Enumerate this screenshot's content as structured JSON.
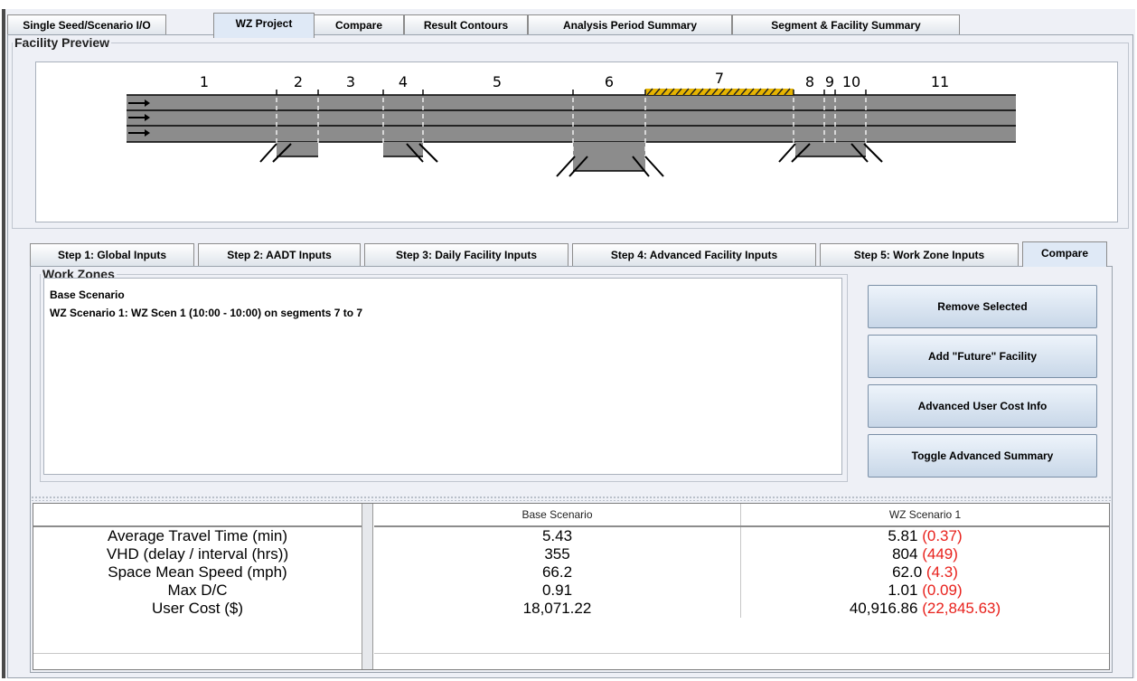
{
  "tabs": [
    {
      "label": "Single Seed/Scenario I/O"
    },
    {
      "label": "WZ Project",
      "active": true
    },
    {
      "label": "Compare"
    },
    {
      "label": "Result Contours"
    },
    {
      "label": "Analysis Period Summary"
    },
    {
      "label": "Segment & Facility Summary"
    }
  ],
  "facility_preview": {
    "legend": "Facility Preview",
    "segment_numbers": [
      "1",
      "2",
      "3",
      "4",
      "5",
      "6",
      "7",
      "8",
      "9",
      "10",
      "11"
    ]
  },
  "step_tabs": [
    {
      "label": "Step 1: Global Inputs"
    },
    {
      "label": "Step 2: AADT Inputs"
    },
    {
      "label": "Step 3: Daily Facility Inputs"
    },
    {
      "label": "Step 4: Advanced Facility Inputs"
    },
    {
      "label": "Step 5: Work Zone Inputs"
    },
    {
      "label": "Compare",
      "active": true
    }
  ],
  "work_zones": {
    "legend": "Work Zones",
    "items": [
      "Base Scenario",
      "WZ Scenario 1: WZ Scen 1 (10:00 - 10:00) on segments 7 to 7"
    ]
  },
  "buttons": {
    "remove": "Remove Selected",
    "add_future": "Add \"Future\" Facility",
    "advanced_cost": "Advanced User Cost Info",
    "toggle_summary": "Toggle Advanced Summary"
  },
  "table": {
    "columns": [
      "Base Scenario",
      "WZ Scenario 1"
    ],
    "rows": [
      {
        "label": "Average Travel Time (min)",
        "base": "5.43",
        "wz": "5.81",
        "delta": "(0.37)"
      },
      {
        "label": "VHD (delay / interval (hrs))",
        "base": "355",
        "wz": "804",
        "delta": "(449)"
      },
      {
        "label": "Space Mean Speed (mph)",
        "base": "66.2",
        "wz": "62.0",
        "delta": "(4.3)"
      },
      {
        "label": "Max D/C",
        "base": "0.91",
        "wz": "1.01",
        "delta": "(0.09)"
      },
      {
        "label": "User Cost ($)",
        "base": "18,071.22",
        "wz": "40,916.86",
        "delta": "(22,845.63)"
      }
    ]
  },
  "colors": {
    "delta": "#e8211c",
    "road": "#8c8c8c",
    "workzone_hatch": "#e6b400"
  }
}
